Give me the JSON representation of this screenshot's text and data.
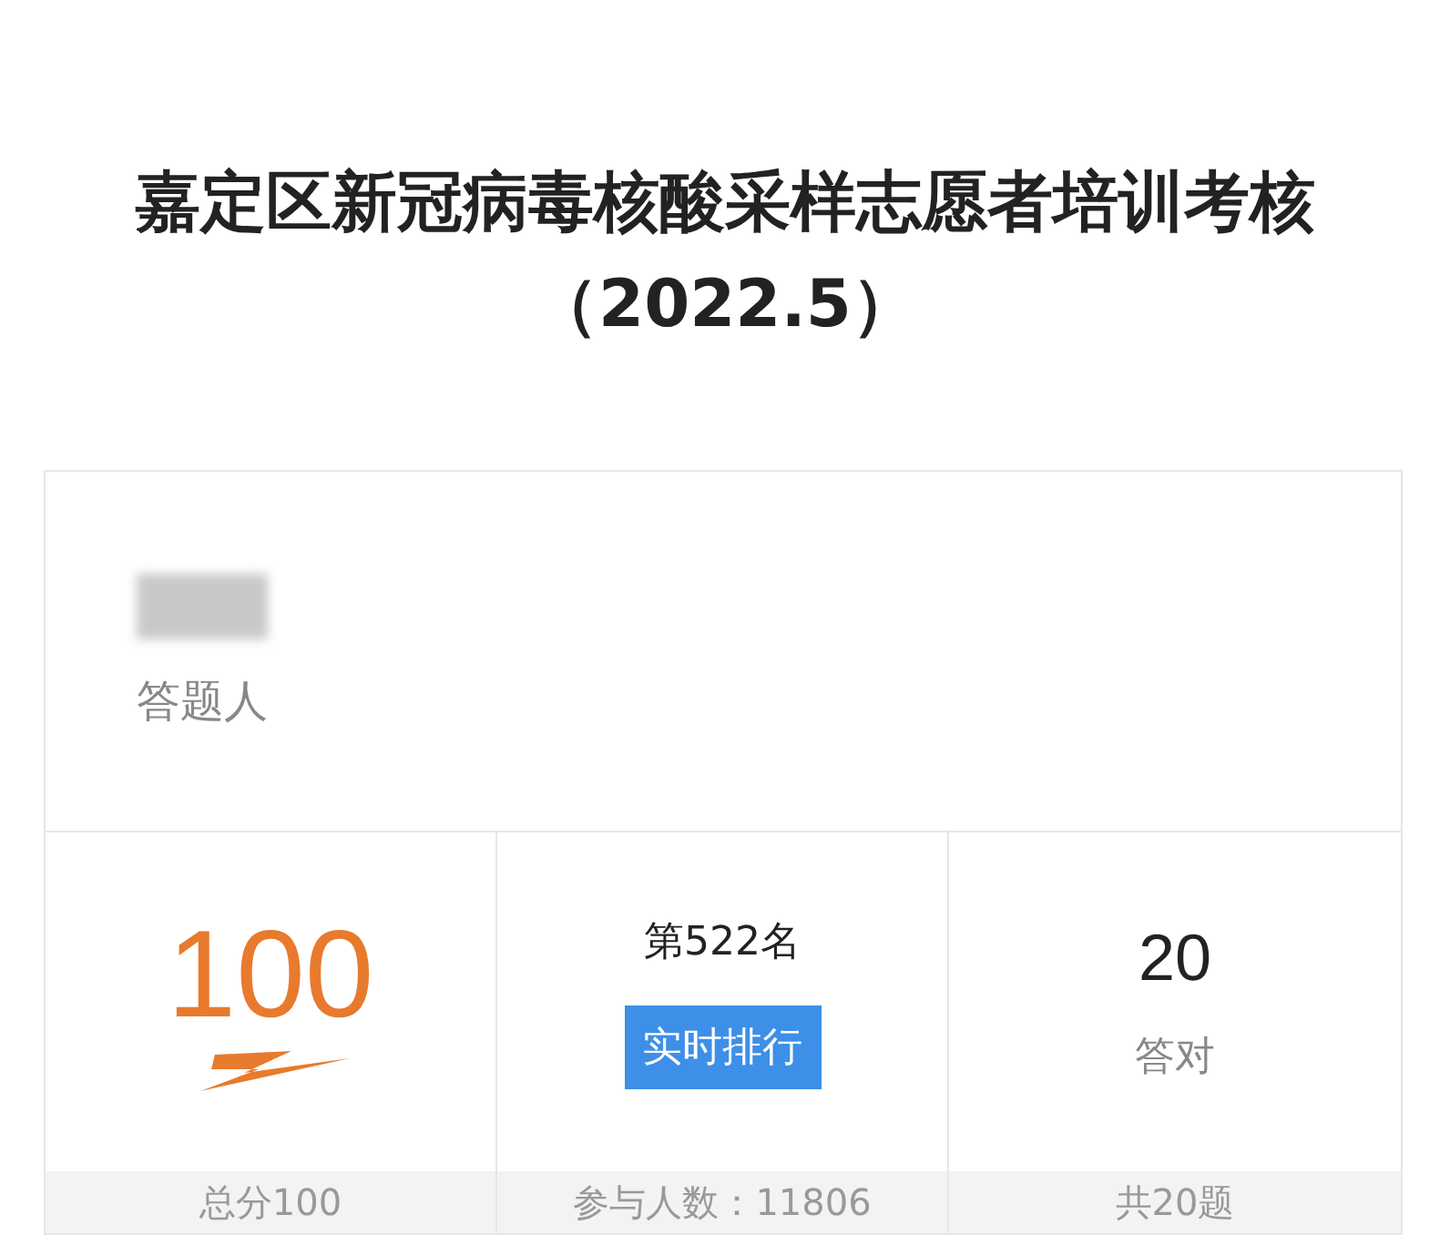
{
  "title": [
    "嘉定区新冠病毒核酸采样志愿者培训考核",
    "（2022.5）"
  ],
  "respondent": {
    "label": "答题人"
  },
  "stats": [
    {
      "kind": "score",
      "value": "100",
      "footer": "总分100"
    },
    {
      "kind": "rank",
      "value": "第522名",
      "button": "实时排行",
      "footer": "参与人数：11806"
    },
    {
      "kind": "count",
      "value": "20",
      "caption": "答对",
      "footer": "共20题"
    }
  ]
}
